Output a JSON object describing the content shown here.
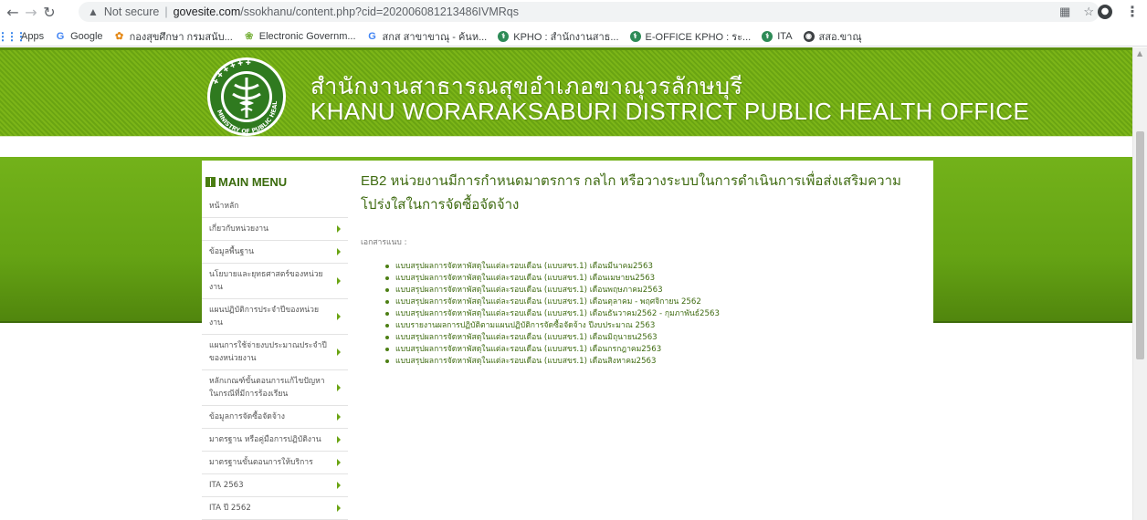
{
  "browser": {
    "not_secure": "Not secure",
    "url_host": "govesite.com",
    "url_rest": "/ssokhanu/content.php?cid=202006081213486IVMRqs",
    "bookmarks": [
      {
        "label": "Apps"
      },
      {
        "label": "Google"
      },
      {
        "label": "กองสุขศึกษา กรมสนับ..."
      },
      {
        "label": "Electronic Governm..."
      },
      {
        "label": "สกส สาขาขาณุ - ค้นห..."
      },
      {
        "label": "KPHO : สำนักงานสาธ..."
      },
      {
        "label": "E-OFFICE KPHO : ระ..."
      },
      {
        "label": "ITA"
      },
      {
        "label": "สสอ.ขาณุ"
      }
    ]
  },
  "header": {
    "title_th": "สำนักงานสาธารณสุขอำเภอขาณุวรลักษบุรี",
    "title_en": "KHANU WORARAKSABURI DISTRICT PUBLIC HEALTH OFFICE",
    "logo_text": "MINISTRY OF PUBLIC HEALTH"
  },
  "sidebar": {
    "heading": "MAIN MENU",
    "items": [
      {
        "label": "หน้าหลัก",
        "arrow": false
      },
      {
        "label": "เกี่ยวกับหน่วยงาน",
        "arrow": true
      },
      {
        "label": "ข้อมูลพื้นฐาน",
        "arrow": true
      },
      {
        "label": "นโยบายและยุทธศาสตร์ของหน่วยงาน",
        "arrow": true
      },
      {
        "label": "แผนปฏิบัติการประจำปีของหน่วยงาน",
        "arrow": true
      },
      {
        "label": "แผนการใช้จ่ายงบประมาณประจำปีของหน่วยงาน",
        "arrow": true
      },
      {
        "label": "หลักเกณฑ์ขั้นตอนการแก้ไขปัญหาในกรณีที่มีการร้องเรียน",
        "arrow": true
      },
      {
        "label": "ข้อมูลการจัดซื้อจัดจ้าง",
        "arrow": true
      },
      {
        "label": "มาตรฐาน หรือคู่มือการปฏิบัติงาน",
        "arrow": true
      },
      {
        "label": "มาตรฐานขั้นตอนการให้บริการ",
        "arrow": true
      },
      {
        "label": "ITA 2563",
        "arrow": true
      },
      {
        "label": "ITA ปี 2562",
        "arrow": true
      }
    ]
  },
  "article": {
    "title": "EB2 หน่วยงานมีการกำหนดมาตรการ กลไก หรือวางระบบในการดำเนินการเพื่อส่งเสริมความโปร่งใสในการจัดซื้อจัดจ้าง",
    "doc_label": "เอกสารแนบ :",
    "documents": [
      "แบบสรุปผลการจัดหาพัสดุในแต่ละรอบเดือน (แบบสขร.1) เดือนมีนาคม2563",
      "แบบสรุปผลการจัดหาพัสดุในแต่ละรอบเดือน (แบบสขร.1) เดือนเมษายน2563",
      "แบบสรุปผลการจัดหาพัสดุในแต่ละรอบเดือน (แบบสขร.1) เดือนพฤษภาคม2563",
      "แบบสรุปผลการจัดหาพัสดุในแต่ละรอบเดือน (แบบสขร.1) เดือนตุลาคม - พฤศจิกายน 2562",
      "แบบสรุปผลการจัดหาพัสดุในแต่ละรอบเดือน (แบบสขร.1) เดือนธันวาคม2562 - กุมภาพันธ์2563",
      "แบบรายงานผลการปฏิบัติตามแผนปฏิบัติการจัดซื้อจัดจ้าง ปีงบประมาณ 2563",
      "แบบสรุปผลการจัดหาพัสดุในแต่ละรอบเดือน (แบบสขร.1) เดือนมิถุนายน2563",
      "แบบสรุปผลการจัดหาพัสดุในแต่ละรอบเดือน (แบบสขร.1) เดือนกรกฎาคม2563",
      "แบบสรุปผลการจัดหาพัสดุในแต่ละรอบเดือน (แบบสขร.1) เดือนสิงหาคม2563"
    ]
  },
  "colors": {
    "header_green": "#7cb518",
    "title_green": "#3f6b11",
    "link_green": "#3f6b11"
  }
}
